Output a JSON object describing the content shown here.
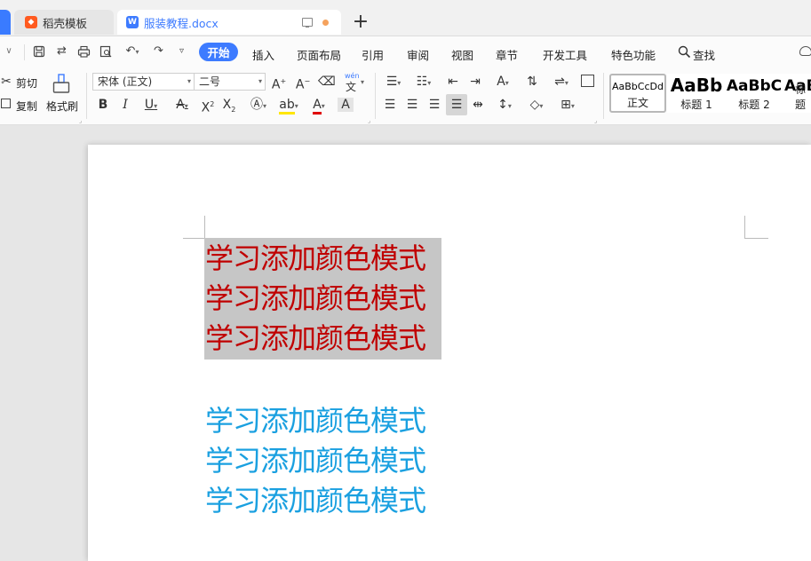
{
  "tabs": [
    {
      "label": "稻壳模板",
      "icon": "daoke-logo-icon"
    },
    {
      "label": "服装教程.docx",
      "icon": "word-doc-icon",
      "active": true
    }
  ],
  "menu": {
    "start": "开始",
    "items": [
      "插入",
      "页面布局",
      "引用",
      "审阅",
      "视图",
      "章节",
      "开发工具",
      "特色功能"
    ],
    "search": "查找"
  },
  "ribbon": {
    "cut": "剪切",
    "copy": "复制",
    "format_painter": "格式刷",
    "font_name": "宋体 (正文)",
    "font_size": "二号",
    "pinyin_glyph": "wén",
    "pinyin_char": "文"
  },
  "styles": [
    {
      "sample": "AaBbCcDd",
      "label": "正文"
    },
    {
      "sample": "AaBb",
      "label": "标题 1"
    },
    {
      "sample": "AaBbC",
      "label": "标题 2"
    },
    {
      "sample": "AaBl",
      "label": "标题"
    }
  ],
  "colors": {
    "accent": "#3d7bff",
    "red_text": "#c00000",
    "blue_text": "#1aa0e0",
    "selection": "#c6c6c6"
  },
  "document": {
    "red_lines": [
      "学习添加颜色模式",
      "学习添加颜色模式",
      "学习添加颜色模式"
    ],
    "blue_lines": [
      "学习添加颜色模式",
      "学习添加颜色模式",
      "学习添加颜色模式"
    ]
  }
}
